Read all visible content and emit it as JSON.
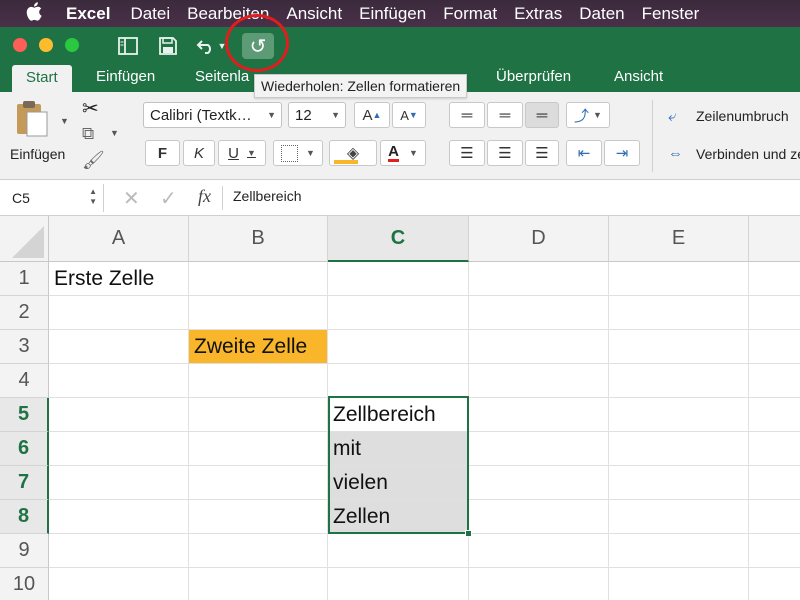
{
  "menubar": {
    "apple_icon": "apple-logo-icon",
    "app_name": "Excel",
    "items": [
      "Datei",
      "Bearbeiten",
      "Ansicht",
      "Einfügen",
      "Format",
      "Extras",
      "Daten",
      "Fenster"
    ]
  },
  "titlebar": {
    "icons": [
      "sidebar-icon",
      "save-icon",
      "undo-icon",
      "redo-icon"
    ]
  },
  "tabs": [
    "Start",
    "Einfügen",
    "Seitenla",
    "Überprüfen",
    "Ansicht"
  ],
  "tooltip": "Wiederholen: Zellen formatieren",
  "ribbon": {
    "paste_label": "Einfügen",
    "font_name": "Calibri (Textk…",
    "font_size": "12",
    "grow_font": "A",
    "shrink_font": "A",
    "bold": "F",
    "italic": "K",
    "underline": "U",
    "wrap_label": "Zeilenumbruch",
    "merge_label": "Verbinden und ze"
  },
  "formula_bar": {
    "name_box": "C5",
    "fx": "fx",
    "value": "Zellbereich"
  },
  "sheet": {
    "columns": [
      "A",
      "B",
      "C",
      "D",
      "E"
    ],
    "rows": [
      "1",
      "2",
      "3",
      "4",
      "5",
      "6",
      "7",
      "8",
      "9",
      "10"
    ],
    "cells": {
      "A1": "Erste Zelle",
      "B3": "Zweite Zelle",
      "C5": "Zellbereich",
      "C6": "mit",
      "C7": "vielen",
      "C8": "Zellen"
    },
    "selected_range": "C5:C8",
    "highlight_color": "#f9b62b",
    "range_fill_color": "#dedede",
    "accent_color": "#1f7244"
  }
}
